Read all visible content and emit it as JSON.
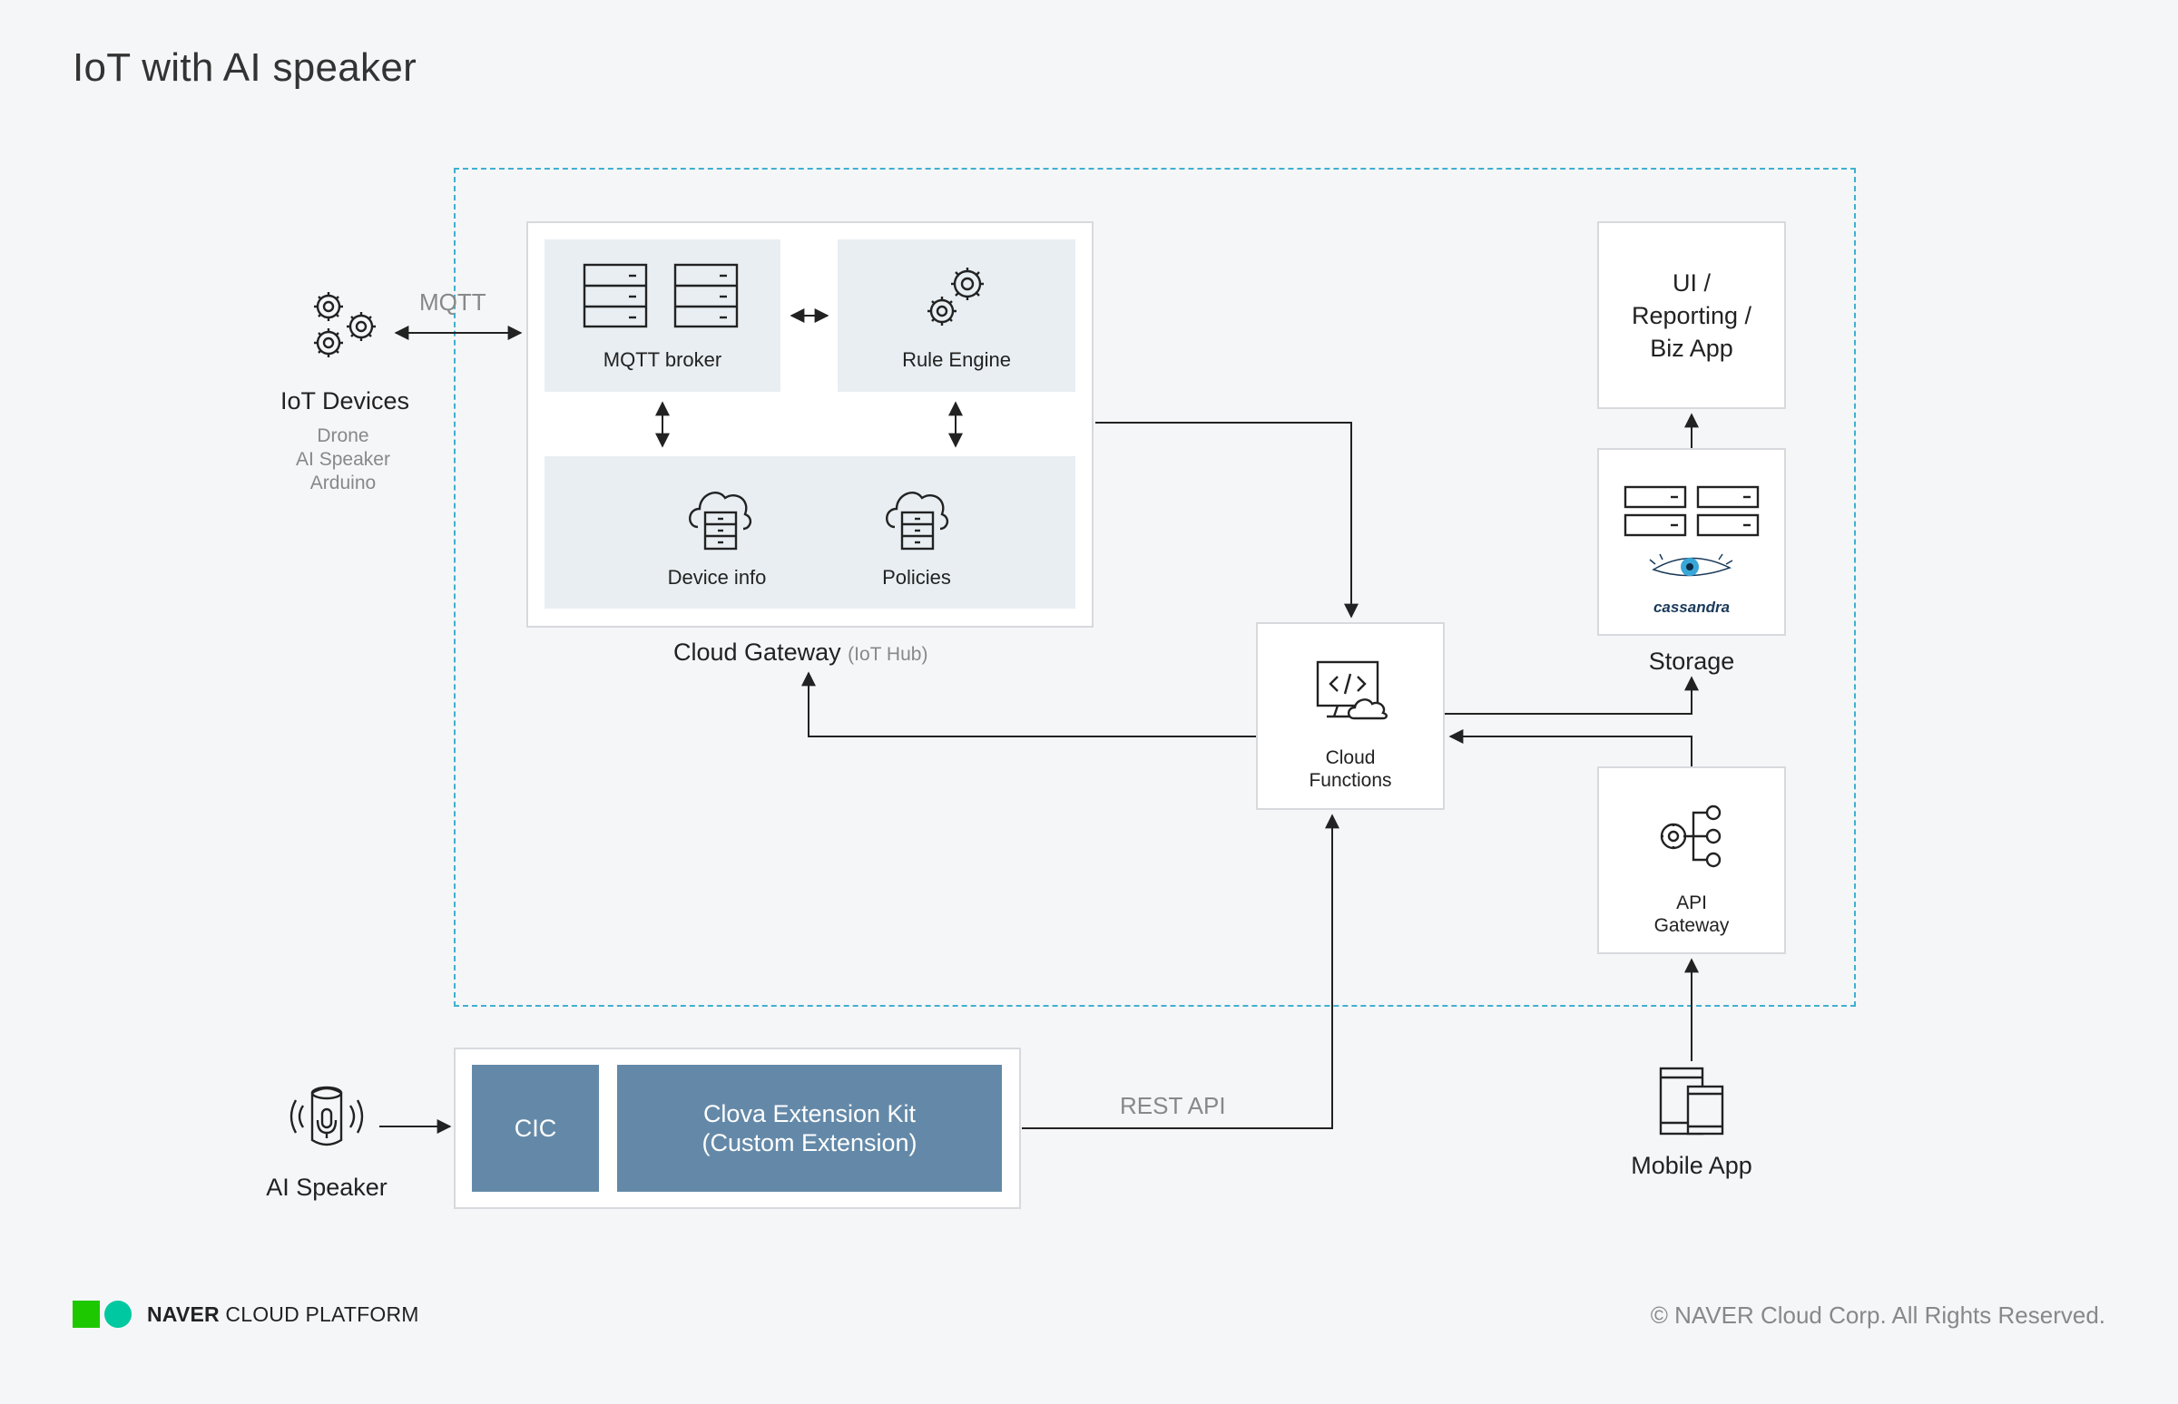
{
  "title": "IoT with AI speaker",
  "iot_devices": {
    "title": "IoT Devices",
    "items": [
      "Drone",
      "AI Speaker",
      "Arduino"
    ],
    "protocol": "MQTT"
  },
  "cloud_gateway": {
    "label": "Cloud Gateway",
    "sublabel": "(IoT Hub)",
    "mqtt_broker": "MQTT broker",
    "rule_engine": "Rule Engine",
    "device_info": "Device info",
    "policies": "Policies"
  },
  "cloud_functions": {
    "line1": "Cloud",
    "line2": "Functions"
  },
  "ui_app": {
    "line1": "UI /",
    "line2": "Reporting /",
    "line3": "Biz App"
  },
  "storage": {
    "label": "Storage",
    "logo_text": "cassandra"
  },
  "api_gateway": {
    "line1": "API",
    "line2": "Gateway"
  },
  "ai_speaker": {
    "label": "AI Speaker"
  },
  "cic": {
    "label": "CIC"
  },
  "cek": {
    "line1": "Clova Extension Kit",
    "line2": "(Custom Extension)"
  },
  "rest_api": "REST API",
  "mobile_app": {
    "label": "Mobile App"
  },
  "footer": {
    "brand_bold": "NAVER",
    "brand_rest": "CLOUD PLATFORM",
    "copyright": "© NAVER Cloud Corp. All Rights Reserved."
  },
  "colors": {
    "dashed_border": "#3fb0d0",
    "panel": "#e8eef2",
    "clova_blue": "#6489a8",
    "logo_green": "#1ec800",
    "logo_teal": "#00c8a0"
  }
}
